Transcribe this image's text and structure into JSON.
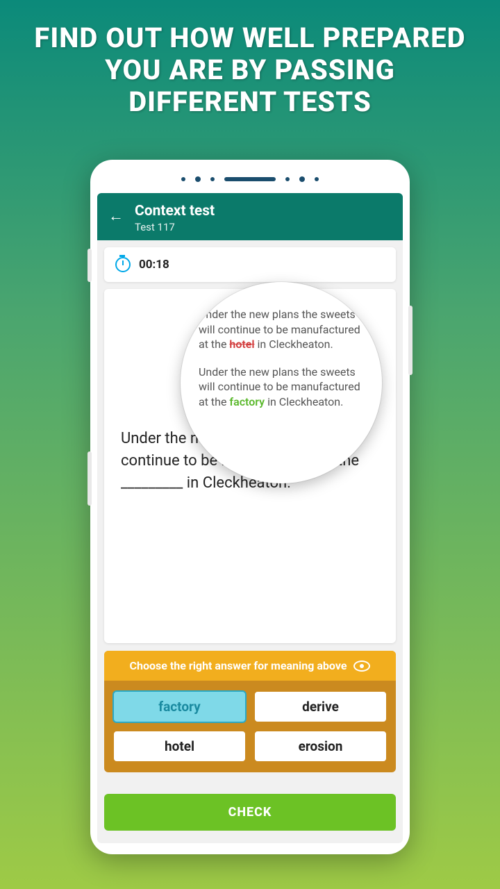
{
  "promo": {
    "title": "FIND OUT HOW WELL PREPARED YOU ARE BY PASSING DIFFERENT TESTS"
  },
  "header": {
    "title": "Context test",
    "subtitle": "Test 117"
  },
  "timer": {
    "value": "00:18"
  },
  "magnifier": {
    "prefix": "Under the new plans the sweets will continue to be manufactured at the ",
    "wrong": "hotel",
    "suffix1": " in Cleckheaton.",
    "prefix2": "Under the new plans the sweets will continue to be manufactured at the ",
    "right": "factory",
    "suffix2": " in Cleckheaton."
  },
  "question": {
    "text": "Under the new plans the sweets will continue to be manufactured at the _________ in Cleckheaton."
  },
  "answers": {
    "prompt": "Choose the right answer for meaning above",
    "options": [
      "factory",
      "derive",
      "hotel",
      "erosion"
    ],
    "selectedIndex": 0
  },
  "check": {
    "label": "CHECK"
  }
}
